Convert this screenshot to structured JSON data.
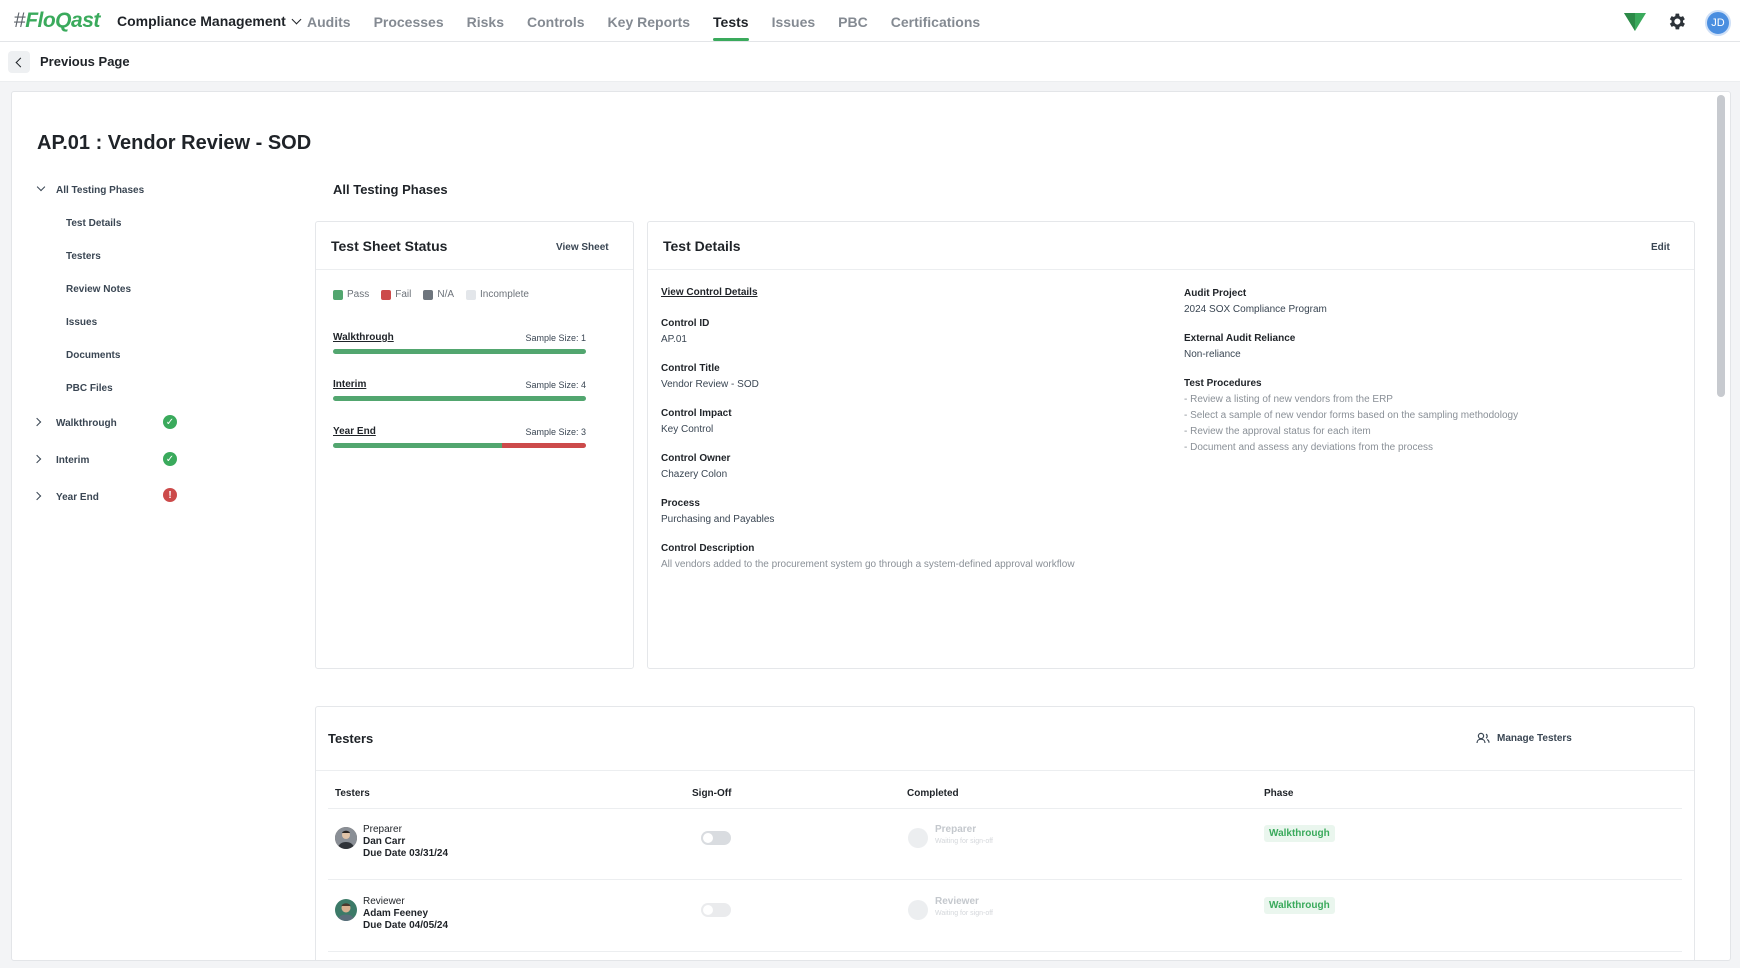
{
  "brand": {
    "hash": "#",
    "name": "FloQast"
  },
  "app_switch": {
    "label": "Compliance Management"
  },
  "nav": {
    "tabs": [
      "Audits",
      "Processes",
      "Risks",
      "Controls",
      "Key Reports",
      "Tests",
      "Issues",
      "PBC",
      "Certifications"
    ],
    "active": "Tests"
  },
  "user": {
    "initials": "JD"
  },
  "back": {
    "label": "Previous Page"
  },
  "page": {
    "title": "AP.01 : Vendor Review - SOD"
  },
  "left_nav": {
    "root": "All Testing Phases",
    "items": [
      "Test Details",
      "Testers",
      "Review Notes",
      "Issues",
      "Documents",
      "PBC Files"
    ],
    "phases": [
      {
        "label": "Walkthrough",
        "status": "pass"
      },
      {
        "label": "Interim",
        "status": "pass"
      },
      {
        "label": "Year End",
        "status": "fail",
        "mark": "!"
      }
    ]
  },
  "section": {
    "title": "All Testing Phases"
  },
  "sheet_status": {
    "title": "Test Sheet Status",
    "view_label": "View Sheet",
    "legend": [
      "Pass",
      "Fail",
      "N/A",
      "Incomplete"
    ],
    "colors": {
      "pass": "#52a66f",
      "fail": "#cc4a4a",
      "na": "#6e757d",
      "incomplete": "#e3e6ea"
    },
    "phases": [
      {
        "name": "Walkthrough",
        "size_label": "Sample Size: 1",
        "pass_fraction": 1.0,
        "fail_fraction": 0.0
      },
      {
        "name": "Interim",
        "size_label": "Sample Size: 4",
        "pass_fraction": 1.0,
        "fail_fraction": 0.0
      },
      {
        "name": "Year End",
        "size_label": "Sample Size: 3",
        "pass_fraction": 0.667,
        "fail_fraction": 0.333
      }
    ]
  },
  "test_details": {
    "title": "Test Details",
    "edit_label": "Edit",
    "view_control": "View Control Details",
    "left": [
      {
        "label": "Control ID",
        "value": "AP.01"
      },
      {
        "label": "Control Title",
        "value": "Vendor Review - SOD"
      },
      {
        "label": "Control Impact",
        "value": "Key Control"
      },
      {
        "label": "Control Owner",
        "value": "Chazery Colon"
      },
      {
        "label": "Process",
        "value": "Purchasing and Payables"
      },
      {
        "label": "Control Description",
        "value": "All vendors added to the procurement system go through a system-defined approval workflow"
      }
    ],
    "right": [
      {
        "label": "Audit Project",
        "value": "2024 SOX Compliance Program"
      },
      {
        "label": "External Audit Reliance",
        "value": "Non-reliance"
      }
    ],
    "procedures_label": "Test Procedures",
    "procedures": [
      "- Review a listing of new vendors from the ERP",
      "- Select a sample of new vendor forms based on the sampling methodology",
      "- Review the approval status for each item",
      "- Document and assess any deviations from the process"
    ]
  },
  "testers": {
    "title": "Testers",
    "manage_label": "Manage Testers",
    "columns": [
      "Testers",
      "Sign-Off",
      "Completed",
      "Phase"
    ],
    "rows": [
      {
        "role": "Preparer",
        "name": "Dan Carr",
        "due": "Due Date 03/31/24",
        "completed_role": "Preparer",
        "completed_status": "Waiting for sign-off",
        "phase": "Walkthrough"
      },
      {
        "role": "Reviewer",
        "name": "Adam Feeney",
        "due": "Due Date 04/05/24",
        "completed_role": "Reviewer",
        "completed_status": "Waiting for sign-off",
        "phase": "Walkthrough"
      }
    ]
  }
}
